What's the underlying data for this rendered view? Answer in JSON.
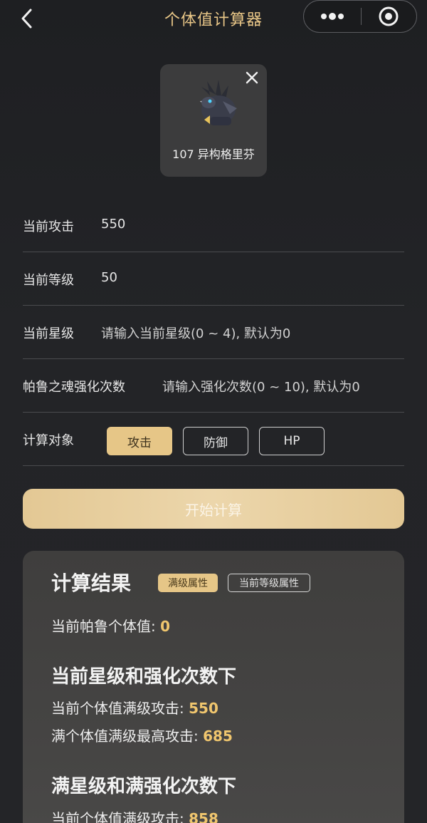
{
  "header": {
    "title": "个体值计算器",
    "back_icon": "chevron-left-icon",
    "more_icon": "more-dots-icon",
    "target_icon": "target-icon"
  },
  "pal": {
    "name": "107 异构格里芬"
  },
  "form": {
    "attack": {
      "label": "当前攻击",
      "value": "550"
    },
    "level": {
      "label": "当前等级",
      "value": "50"
    },
    "star": {
      "label": "当前星级",
      "placeholder": "请输入当前星级(0 ~ 4), 默认为0"
    },
    "souls": {
      "label": "帕鲁之魂强化次数",
      "placeholder": "请输入强化次数(0 ~ 10), 默认为0"
    },
    "target": {
      "label": "计算对象",
      "options": [
        "攻击",
        "防御",
        "HP"
      ],
      "selected": "攻击"
    }
  },
  "calc_button": "开始计算",
  "result": {
    "title": "计算结果",
    "tabs": [
      "满级属性",
      "当前等级属性"
    ],
    "selected_tab": "满级属性",
    "current_iv_label": "当前帕鲁个体值:",
    "current_iv_value": "0",
    "section1": {
      "title": "当前星级和强化次数下",
      "line1_label": "当前个体值满级攻击:",
      "line1_value": "550",
      "line2_label": "满个体值满级最高攻击:",
      "line2_value": "685"
    },
    "section2": {
      "title": "满星级和满强化次数下",
      "line1_label": "当前个体值满级攻击:",
      "line1_value": "858"
    }
  },
  "colors": {
    "accent": "#e6c687",
    "value_highlight": "#f0c66e",
    "background": "#222326"
  }
}
